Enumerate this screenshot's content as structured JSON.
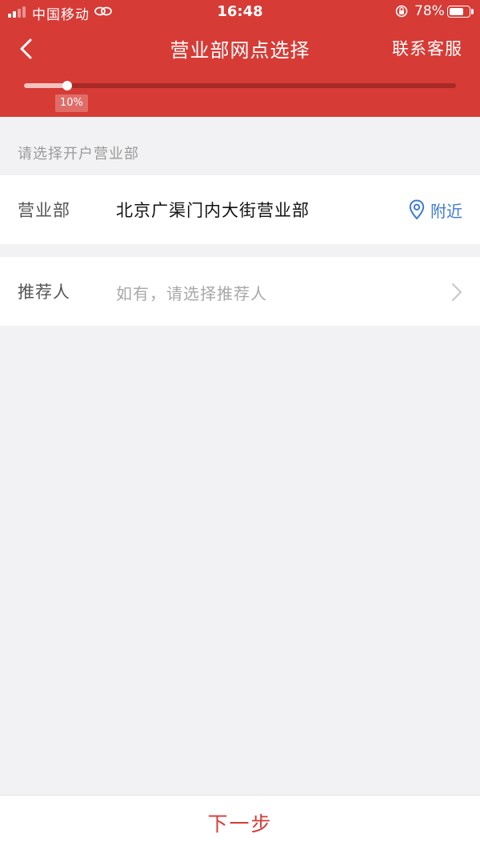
{
  "status_bar": {
    "carrier": "中国移动",
    "time": "16:48",
    "battery_percent": "78%",
    "battery_level": 0.78,
    "icons": [
      "signal-icon",
      "link-icon",
      "orientation-lock-icon",
      "battery-icon"
    ]
  },
  "nav": {
    "back_icon": "chevron-left-icon",
    "title": "营业部网点选择",
    "contact_label": "联系客服"
  },
  "progress": {
    "value": 0.1,
    "label": "10%"
  },
  "form": {
    "section_hint": "请选择开户营业部",
    "branch": {
      "label": "营业部",
      "value": "北京广渠门内大街营业部",
      "nearby_label": "附近",
      "nearby_icon": "location-pin-icon"
    },
    "referrer": {
      "label": "推荐人",
      "placeholder": "如有，请选择推荐人",
      "chevron_icon": "chevron-right-icon"
    }
  },
  "footer": {
    "next_label": "下一步"
  },
  "colors": {
    "brand_red": "#d63b36",
    "link_blue": "#3f7ad8",
    "background": "#f2f2f4"
  }
}
